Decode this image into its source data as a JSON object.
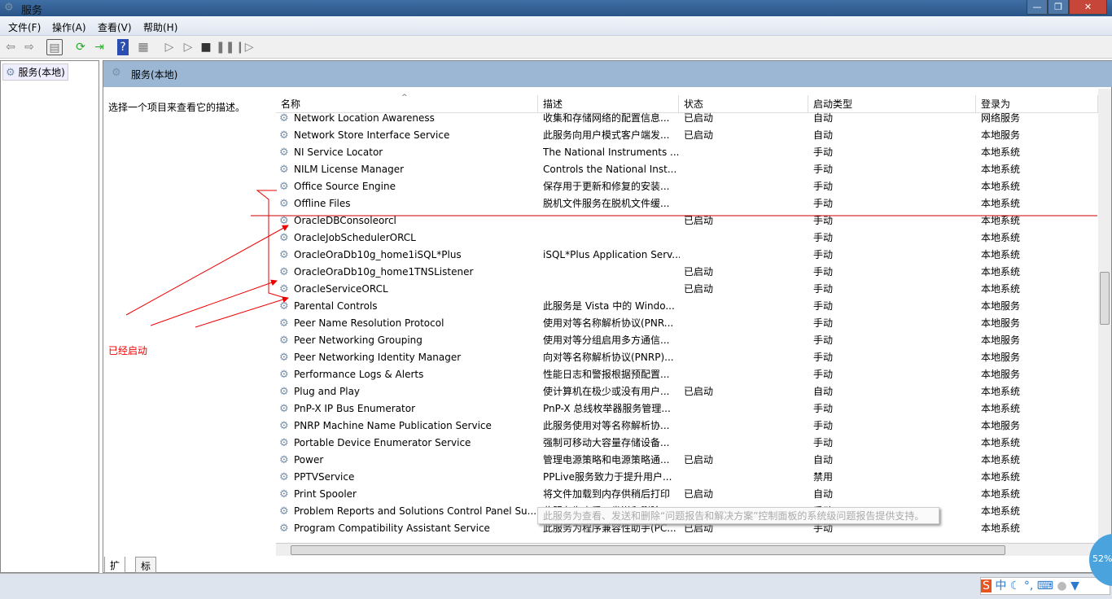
{
  "window": {
    "title": "服务",
    "min": "—",
    "max": "❐",
    "close": "✕"
  },
  "menu": [
    "文件(F)",
    "操作(A)",
    "查看(V)",
    "帮助(H)"
  ],
  "toolbar": {
    "icons": [
      "back-icon",
      "forward-icon",
      "console-tree-icon",
      "refresh-icon",
      "export-icon",
      "help-icon",
      "properties-icon",
      "start-icon",
      "start-alt-icon",
      "stop-icon",
      "pause-icon",
      "resume-icon"
    ]
  },
  "left": {
    "node": "服务(本地)"
  },
  "right": {
    "header": "服务(本地)",
    "description": "选择一个项目来查看它的描述。",
    "annotation": "已经启动"
  },
  "columns": [
    "名称",
    "描述",
    "状态",
    "启动类型",
    "登录为"
  ],
  "rows": [
    [
      "Network Location Awareness",
      "收集和存储网络的配置信息...",
      "已启动",
      "自动",
      "网络服务"
    ],
    [
      "Network Store Interface Service",
      "此服务向用户模式客户端发...",
      "已启动",
      "自动",
      "本地服务"
    ],
    [
      "NI Service Locator",
      "The National Instruments ...",
      "",
      "手动",
      "本地系统"
    ],
    [
      "NILM License Manager",
      "Controls the National Inst...",
      "",
      "手动",
      "本地系统"
    ],
    [
      "Office Source Engine",
      "保存用于更新和修复的安装...",
      "",
      "手动",
      "本地系统"
    ],
    [
      "Offline Files",
      "脱机文件服务在脱机文件缓...",
      "",
      "手动",
      "本地系统"
    ],
    [
      "OracleDBConsoleorcl",
      "",
      "已启动",
      "手动",
      "本地系统"
    ],
    [
      "OracleJobSchedulerORCL",
      "",
      "",
      "手动",
      "本地系统"
    ],
    [
      "OracleOraDb10g_home1iSQL*Plus",
      "iSQL*Plus Application Serv...",
      "",
      "手动",
      "本地系统"
    ],
    [
      "OracleOraDb10g_home1TNSListener",
      "",
      "已启动",
      "手动",
      "本地系统"
    ],
    [
      "OracleServiceORCL",
      "",
      "已启动",
      "手动",
      "本地系统"
    ],
    [
      "Parental Controls",
      "此服务是 Vista 中的 Windo...",
      "",
      "手动",
      "本地服务"
    ],
    [
      "Peer Name Resolution Protocol",
      "使用对等名称解析协议(PNR...",
      "",
      "手动",
      "本地服务"
    ],
    [
      "Peer Networking Grouping",
      "使用对等分组启用多方通信...",
      "",
      "手动",
      "本地服务"
    ],
    [
      "Peer Networking Identity Manager",
      "向对等名称解析协议(PNRP)...",
      "",
      "手动",
      "本地服务"
    ],
    [
      "Performance Logs & Alerts",
      "性能日志和警报根据预配置...",
      "",
      "手动",
      "本地服务"
    ],
    [
      "Plug and Play",
      "使计算机在极少或没有用户...",
      "已启动",
      "自动",
      "本地系统"
    ],
    [
      "PnP-X IP Bus Enumerator",
      "PnP-X 总线枚举器服务管理...",
      "",
      "手动",
      "本地系统"
    ],
    [
      "PNRP Machine Name Publication Service",
      "此服务使用对等名称解析协...",
      "",
      "手动",
      "本地服务"
    ],
    [
      "Portable Device Enumerator Service",
      "强制可移动大容量存储设备...",
      "",
      "手动",
      "本地系统"
    ],
    [
      "Power",
      "管理电源策略和电源策略通...",
      "已启动",
      "自动",
      "本地系统"
    ],
    [
      "PPTVService",
      "PPLive服务致力于提升用户...",
      "",
      "禁用",
      "本地系统"
    ],
    [
      "Print Spooler",
      "将文件加载到内存供稍后打印",
      "已启动",
      "自动",
      "本地系统"
    ],
    [
      "Problem Reports and Solutions Control Panel Su...",
      "此服务为查看、发送和删除...",
      "",
      "手动",
      "本地系统"
    ],
    [
      "Program Compatibility Assistant Service",
      "此服务为程序兼容性助手(PC...",
      "已启动",
      "手动",
      "本地系统"
    ]
  ],
  "tooltip": "此服务为查看、发送和删除“问题报告和解决方案”控制面板的系统级问题报告提供支持。",
  "tabs": [
    "扩展",
    "标准"
  ],
  "tray": {
    "ime": "中",
    "badge": "52%"
  },
  "colors": {
    "annotation": "#ff0000",
    "header": "#9cb7d4"
  }
}
